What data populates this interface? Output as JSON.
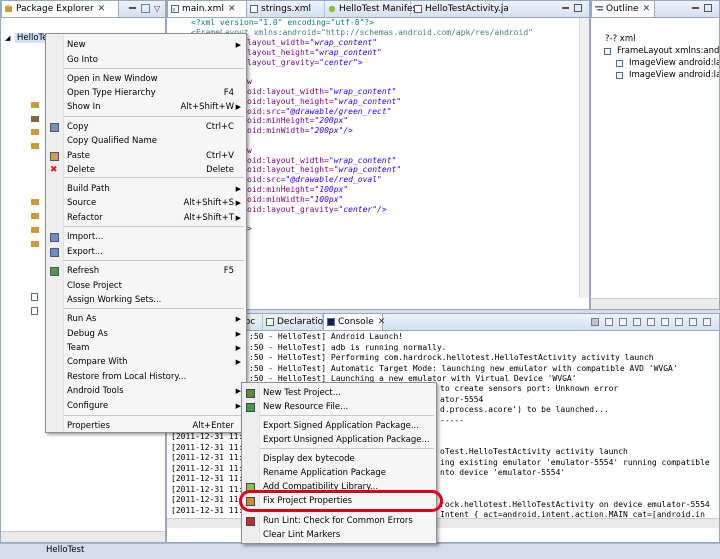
{
  "package_explorer": {
    "tab_label": "Package Explorer",
    "close": "✕",
    "root_item": "HelloTest"
  },
  "editor": {
    "tabs": [
      "main.xml",
      "strings.xml",
      "HelloTest Manifest",
      "HelloTestActivity.ja"
    ],
    "lines": [
      "<?xml version=\"1.0\" encoding=\"utf-8\"?>",
      "<FrameLayout xmlns:android=\"http://schemas.android.com/apk/res/android\"",
      "    android:layout_width=\"wrap_content\"",
      "    android:layout_height=\"wrap_content\"",
      "    android:layout_gravity=\"center\">",
      "",
      "    <ImageView",
      "        android:layout_width=\"wrap_content\"",
      "        android:layout_height=\"wrap_content\"",
      "        android:src=\"@drawable/green_rect\"",
      "        android:minHeight=\"200px\"",
      "        android:minWidth=\"200px\"/>",
      "",
      "    <ImageView",
      "        android:layout_width=\"wrap_content\"",
      "        android:layout_height=\"wrap_content\"",
      "        android:src=\"@drawable/red_oval\"",
      "        android:minHeight=\"100px\"",
      "        android:minWidth=\"100px\"",
      "        android:layout_gravity=\"center\"/>",
      "",
      "</FrameLayout>"
    ],
    "visible_lines": [
      {
        "attr": "layout_width=",
        "val": "\"wrap_content\""
      },
      {
        "attr": "layout_height=",
        "val": "\"wrap_content\""
      },
      {
        "attr": "layout_gravity=",
        "val": "\"center\">"
      },
      {
        "attr": "",
        "val": ""
      },
      {
        "attr": "w",
        "val": ""
      },
      {
        "attr": "oid:layout_width=",
        "val": "\"wrap_content\""
      },
      {
        "attr": "oid:layout_height=",
        "val": "\"wrap_content\""
      },
      {
        "attr": "oid:src=",
        "val": "\"@drawable/green_rect\""
      },
      {
        "attr": "oid:minHeight=",
        "val": "\"200px\""
      },
      {
        "attr": "oid:minWidth=",
        "val": "\"200px\"/>"
      },
      {
        "attr": "",
        "val": ""
      },
      {
        "attr": "w",
        "val": ""
      },
      {
        "attr": "oid:layout_width=",
        "val": "\"wrap_content\""
      },
      {
        "attr": "oid:layout_height=",
        "val": "\"wrap_content\""
      },
      {
        "attr": "oid:src=",
        "val": "\"@drawable/red_oval\""
      },
      {
        "attr": "oid:minHeight=",
        "val": "\"100px\""
      },
      {
        "attr": "oid:minWidth=",
        "val": "\"100px\""
      },
      {
        "attr": "oid:layout_gravity=",
        "val": "\"center\"/>"
      },
      {
        "attr": "",
        "val": ""
      },
      {
        "attr": ">",
        "val": ""
      }
    ],
    "line1": "<?xml version=\"1.0\" encoding=\"utf-8\"?>",
    "line2": "<FrameLayout xmlns:android=\"http://schemas.android.com/apk/res/android\""
  },
  "outline": {
    "tab_label": "Outline",
    "items": [
      "?-? xml",
      "FrameLayout xmlns:andro",
      "ImageView android:lay",
      "ImageView android:lay"
    ]
  },
  "bottom_tabs": {
    "javadoc_partial": "doc",
    "declaration": "Declaration",
    "console": "Console"
  },
  "console_lines_visible": [
    ":50 - HelloTest] Android Launch!",
    ":50 - HelloTest] adb is running normally.",
    ":50 - HelloTest] Performing com.hardrock.hellotest.HelloTestActivity activity launch",
    ":50 - HelloTest] Automatic Target Mode: launching new emulator with compatible AVD 'WVGA'",
    ":50 - HelloTest] Launching a new emulator with Virtual Device 'WVGA'"
  ],
  "console_right_fragments": [
    "to create sensors port: Unknown error",
    "ator-5554",
    "d.process.acore') to be launched...",
    "-----",
    "",
    "",
    "oTest.HelloTestActivity activity launch",
    "ing existing emulator 'emulator-5554' running compatible",
    "nto device 'emulator-5554'",
    "",
    "",
    "rock.hellotest.HelloTestActivity on device emulator-5554",
    "Intent { act=android.intent.action.MAIN cat=[android.in"
  ],
  "console_left_fragments": [
    "[2011-12-31 11:1",
    "[2011-12-31 11:1",
    "[2011-12-31 11:1",
    "[2011-12-31 11:1",
    "[2011-12-31 11:1",
    "[2011-12-31 11:1",
    "[2011-12-31 11:1",
    "[2011-12-31 11:1"
  ],
  "context_menu": {
    "items": [
      {
        "label": "New",
        "shortcut": "",
        "arrow": "▶"
      },
      {
        "label": "Go Into",
        "shortcut": "",
        "arrow": ""
      },
      {
        "label": "Open in New Window",
        "shortcut": "",
        "arrow": ""
      },
      {
        "label": "Open Type Hierarchy",
        "shortcut": "F4",
        "arrow": ""
      },
      {
        "label": "Show In",
        "shortcut": "Alt+Shift+W",
        "arrow": "▶"
      },
      {
        "label": "Copy",
        "shortcut": "Ctrl+C",
        "arrow": ""
      },
      {
        "label": "Copy Qualified Name",
        "shortcut": "",
        "arrow": ""
      },
      {
        "label": "Paste",
        "shortcut": "Ctrl+V",
        "arrow": ""
      },
      {
        "label": "Delete",
        "shortcut": "Delete",
        "arrow": ""
      },
      {
        "label": "Build Path",
        "shortcut": "",
        "arrow": "▶"
      },
      {
        "label": "Source",
        "shortcut": "Alt+Shift+S",
        "arrow": "▶"
      },
      {
        "label": "Refactor",
        "shortcut": "Alt+Shift+T",
        "arrow": "▶"
      },
      {
        "label": "Import...",
        "shortcut": "",
        "arrow": ""
      },
      {
        "label": "Export...",
        "shortcut": "",
        "arrow": ""
      },
      {
        "label": "Refresh",
        "shortcut": "F5",
        "arrow": ""
      },
      {
        "label": "Close Project",
        "shortcut": "",
        "arrow": ""
      },
      {
        "label": "Assign Working Sets...",
        "shortcut": "",
        "arrow": ""
      },
      {
        "label": "Run As",
        "shortcut": "",
        "arrow": "▶"
      },
      {
        "label": "Debug As",
        "shortcut": "",
        "arrow": "▶"
      },
      {
        "label": "Team",
        "shortcut": "",
        "arrow": "▶"
      },
      {
        "label": "Compare With",
        "shortcut": "",
        "arrow": "▶"
      },
      {
        "label": "Restore from Local History...",
        "shortcut": "",
        "arrow": ""
      },
      {
        "label": "Android Tools",
        "shortcut": "",
        "arrow": "▶"
      },
      {
        "label": "Configure",
        "shortcut": "",
        "arrow": "▶"
      },
      {
        "label": "Properties",
        "shortcut": "Alt+Enter",
        "arrow": ""
      }
    ]
  },
  "submenu": {
    "items": [
      "New Test Project...",
      "New Resource File...",
      "Export Signed Application Package...",
      "Export Unsigned Application Package...",
      "Display dex bytecode",
      "Rename Application Package",
      "Add Compatibility Library...",
      "Fix Project Properties",
      "Run Lint: Check for Common Errors",
      "Clear Lint Markers"
    ],
    "highlight_color": "#d9001b"
  },
  "status_bar": {
    "project": "HelloTest"
  }
}
